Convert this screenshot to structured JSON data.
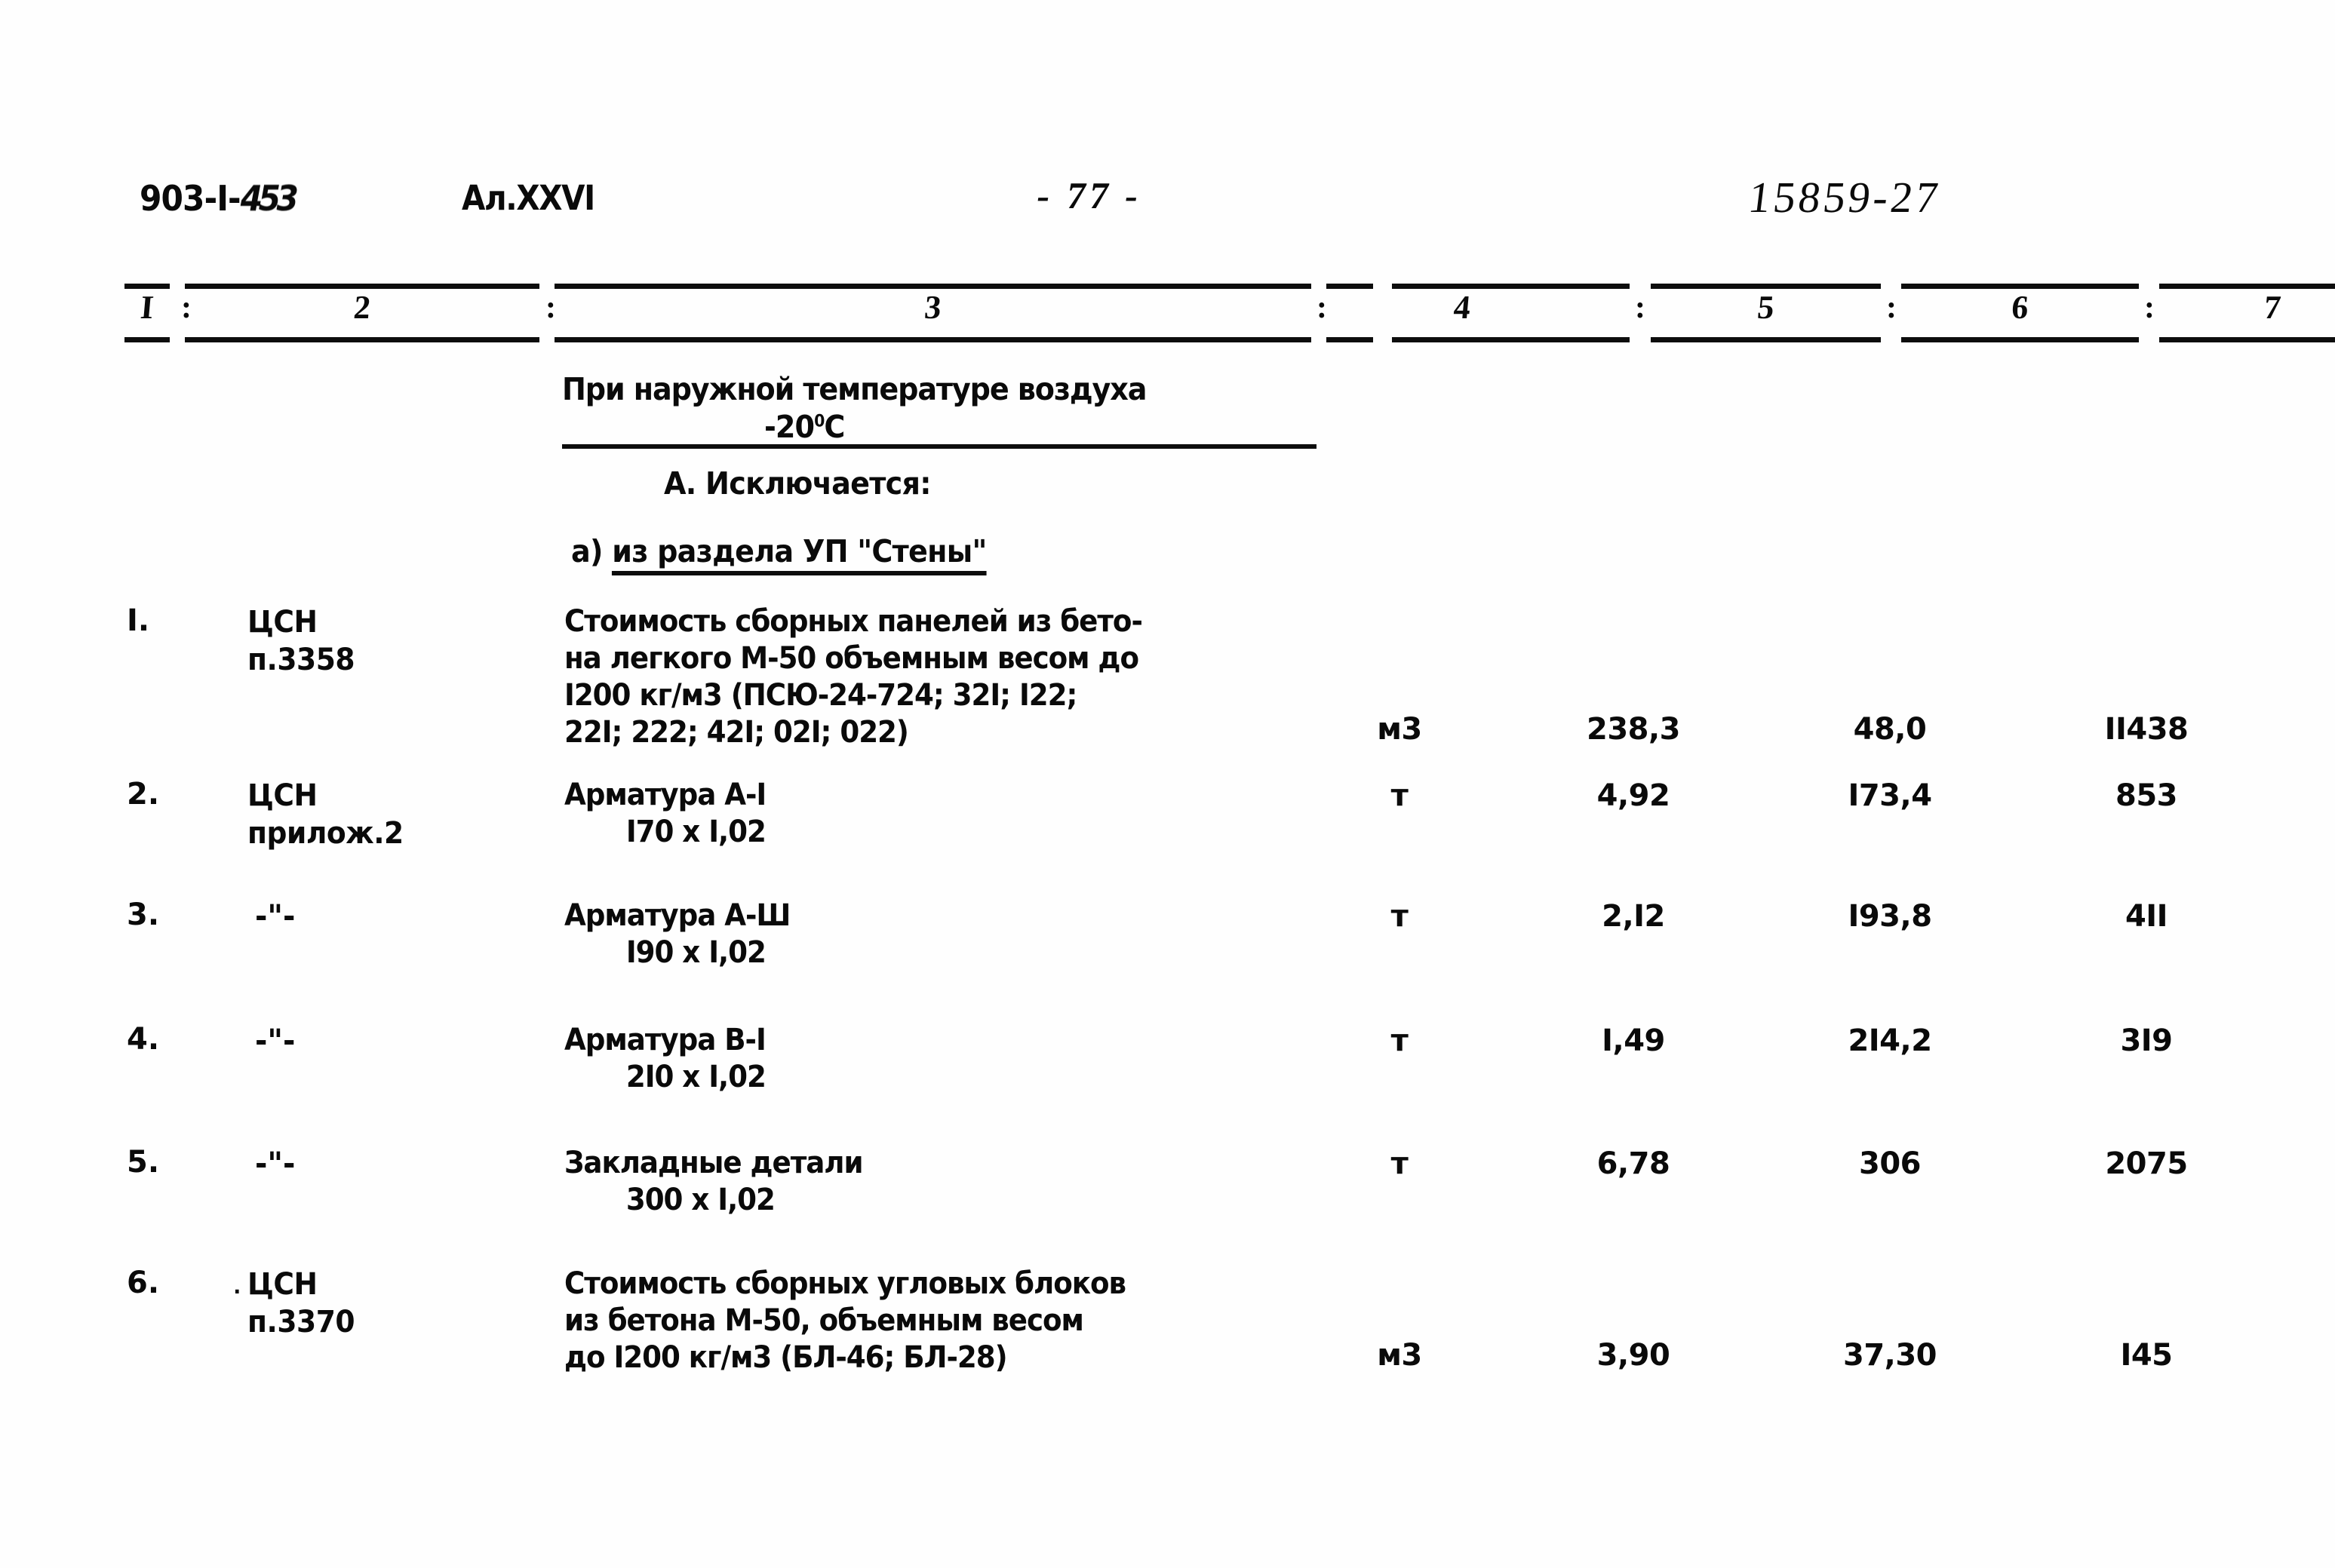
{
  "header": {
    "doc_code_prefix": "903-I-",
    "doc_code_suffix": "453",
    "album": "Ал.XXVI",
    "page_number": "- 77 -",
    "stamp_number": "15859-27"
  },
  "table": {
    "column_headers": [
      "I",
      "2",
      "3",
      "4",
      "5",
      "6",
      "7"
    ],
    "separator": ":",
    "title": {
      "line1": "При наружной температуре воздуха",
      "line2_prefix": "-20",
      "line2_degree": "0",
      "line2_suffix": "С"
    },
    "section_a": "А. Исключается:",
    "subsection_a": {
      "marker": "а)",
      "text": "из раздела УП \"Стены\""
    },
    "rows": [
      {
        "no": "I.",
        "ref_line1": "ЦСН",
        "ref_line2": "п.3358",
        "ref_ditto": false,
        "desc_lines": [
          "Стоимость сборных панелей из бето-",
          "на легкого М-50 объемным весом до",
          "I200 кг/м3 (ПСЮ-24-724; 32I; I22;",
          "22I; 222; 42I; 02I; 022)"
        ],
        "desc_indent_line": -1,
        "unit": "м3",
        "qty": "238,3",
        "price": "48,0",
        "total": "II438"
      },
      {
        "no": "2.",
        "ref_line1": "ЦСН",
        "ref_line2": "прилож.2",
        "ref_ditto": false,
        "desc_lines": [
          "Арматура А-I",
          "I70 х I,02"
        ],
        "desc_indent_line": 1,
        "unit": "т",
        "qty": "4,92",
        "price": "I73,4",
        "total": "853"
      },
      {
        "no": "3.",
        "ref_line1": "-\"-",
        "ref_line2": "",
        "ref_ditto": true,
        "desc_lines": [
          "Арматура А-Ш",
          "I90 х I,02"
        ],
        "desc_indent_line": 1,
        "unit": "т",
        "qty": "2,I2",
        "price": "I93,8",
        "total": "4II"
      },
      {
        "no": "4.",
        "ref_line1": "-\"-",
        "ref_line2": "",
        "ref_ditto": true,
        "desc_lines": [
          "Арматура В-I",
          "2I0 х I,02"
        ],
        "desc_indent_line": 1,
        "unit": "т",
        "qty": "I,49",
        "price": "2I4,2",
        "total": "3I9"
      },
      {
        "no": "5.",
        "ref_line1": "-\"-",
        "ref_line2": "",
        "ref_ditto": true,
        "desc_lines": [
          "Закладные детали",
          "300 х I,02"
        ],
        "desc_indent_line": 1,
        "unit": "т",
        "qty": "6,78",
        "price": "306",
        "total": "2075"
      },
      {
        "no": "6.",
        "ref_line1": "ЦСН",
        "ref_line2": "п.3370",
        "ref_ditto": false,
        "ref_dot": "·",
        "desc_lines": [
          "Стоимость сборных угловых блоков",
          "из бетона М-50, объемным весом",
          "до I200 кг/м3 (БЛ-46; БЛ-28)"
        ],
        "desc_indent_line": -1,
        "unit": "м3",
        "qty": "3,90",
        "price": "37,30",
        "total": "I45"
      }
    ]
  }
}
